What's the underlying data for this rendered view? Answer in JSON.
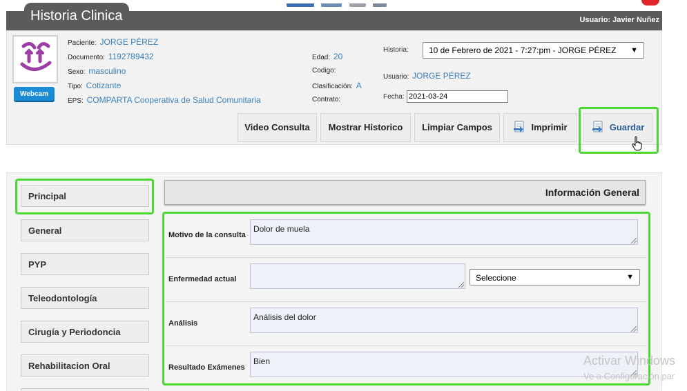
{
  "header": {
    "app_title": "Historia Clinica",
    "user_label": "Usuario: Javier Nuñez"
  },
  "patient": {
    "webcam_label": "Webcam",
    "paciente_label": "Paciente:",
    "paciente_value": "JORGE PÉREZ",
    "documento_label": "Documento:",
    "documento_value": "1192789432",
    "sexo_label": "Sexo:",
    "sexo_value": "masculino",
    "tipo_label": "Tipo:",
    "tipo_value": "Cotizante",
    "eps_label": "EPS:",
    "eps_value": "COMPARTA Cooperativa de Salud Comunitaria",
    "edad_label": "Edad:",
    "edad_value": "20",
    "codigo_label": "Codigo:",
    "clasificacion_label": "Clasificación:",
    "clasificacion_value": "A",
    "contrato_label": "Contrato:",
    "historia_label": "Historia:",
    "historia_value": "10 de Febrero de 2021 - 7:27:pm - JORGE PÉREZ",
    "usuario_label": "Usuario:",
    "usuario_value": "JORGE PÉREZ",
    "fecha_label": "Fecha:",
    "fecha_value": "2021-03-24"
  },
  "actions": {
    "video": "Video Consulta",
    "historico": "Mostrar Historico",
    "limpiar": "Limpiar Campos",
    "imprimir": "Imprimir",
    "guardar": "Guardar"
  },
  "nav": {
    "items": [
      {
        "label": "Principal"
      },
      {
        "label": "General"
      },
      {
        "label": "PYP"
      },
      {
        "label": "Teleodontología"
      },
      {
        "label": "Cirugía y Periodoncia"
      },
      {
        "label": "Rehabilitacion Oral"
      }
    ]
  },
  "main": {
    "section_title": "Información General",
    "motivo_label": "Motivo de la consulta",
    "motivo_value": "Dolor de muela",
    "enfermedad_label": "Enfermedad actual",
    "enfermedad_value": "",
    "enfermedad_select": "Seleccione",
    "analisis_label": "Análisis",
    "analisis_value": "Análisis del dolor",
    "resultado_label": "Resultado Exámenes",
    "resultado_value": "Bien"
  },
  "watermark": {
    "line1": "Activar Windows",
    "line2": "Ve a Configuración par"
  },
  "colors": {
    "header_gray": "#5b5b5b",
    "link_blue": "#3a7fb8",
    "highlight_green": "#4cd832",
    "webcam_blue": "#1a8ad2"
  }
}
